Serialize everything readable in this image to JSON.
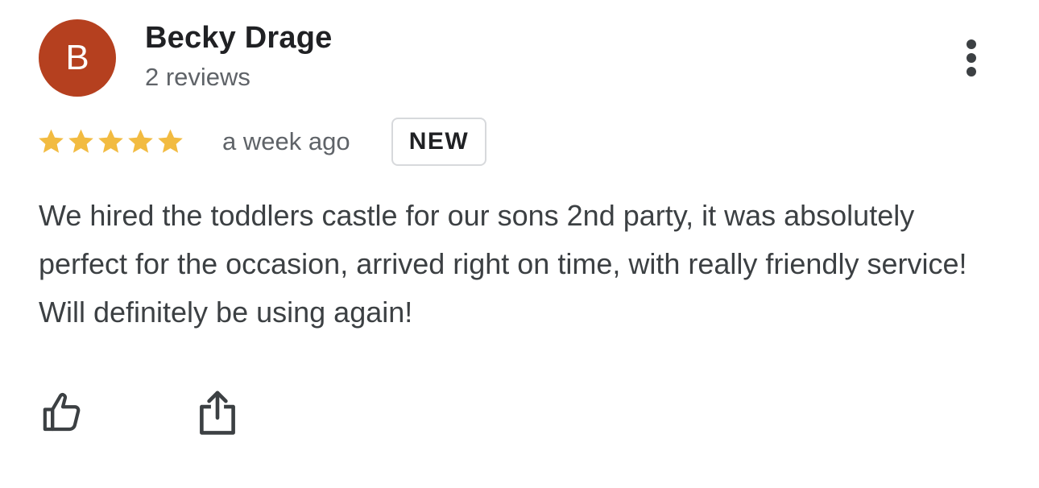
{
  "reviewer": {
    "avatar_letter": "B",
    "avatar_color": "#b5401f",
    "name": "Becky Drage",
    "review_count": "2 reviews"
  },
  "review": {
    "rating": 5,
    "rating_max": 5,
    "star_color": "#f2bb41",
    "time_ago": "a week ago",
    "badge": "NEW",
    "text": "We hired the toddlers castle for our sons 2nd party, it was absolutely perfect for the occasion, arrived right on time, with really friendly service! Will definitely be using again!"
  },
  "actions": {
    "more_icon": "more-vertical-icon",
    "like_icon": "thumbs-up-icon",
    "share_icon": "share-icon"
  }
}
